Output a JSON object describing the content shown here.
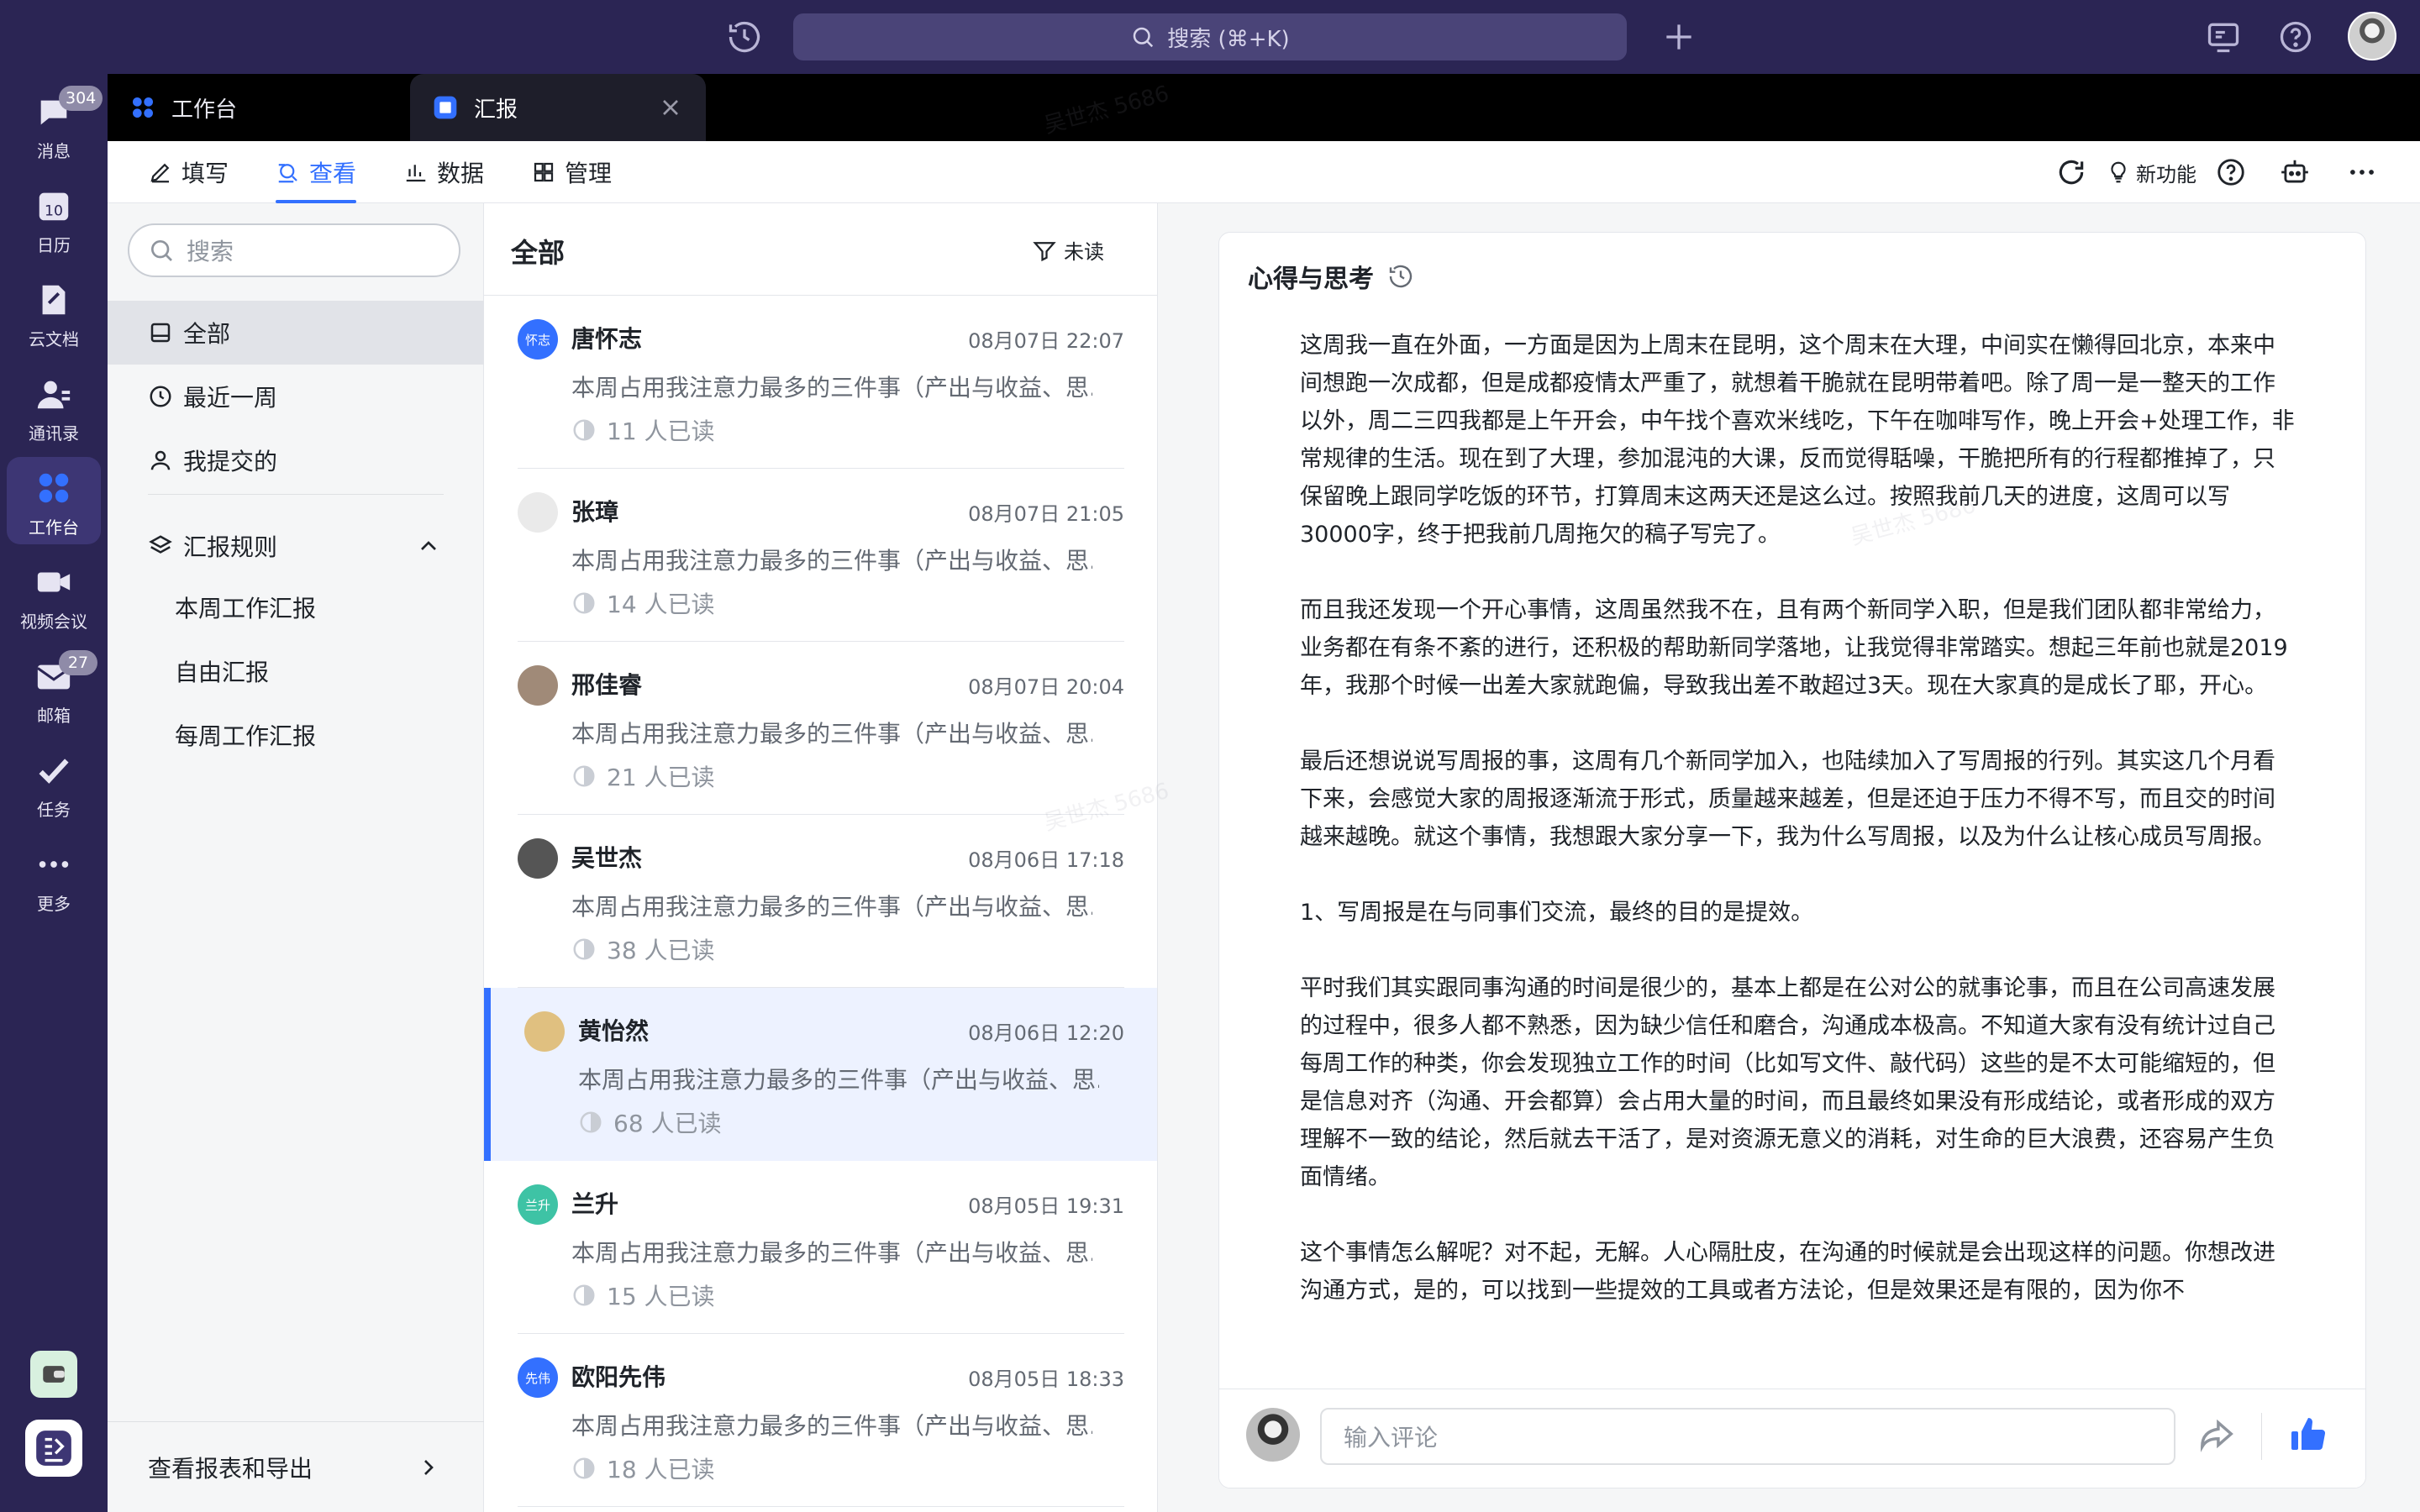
{
  "topbar": {
    "search_label": "搜索 (⌘+K)"
  },
  "rail": {
    "items": [
      {
        "label": "消息",
        "badge": "304"
      },
      {
        "label": "日历",
        "calendar_day": "10"
      },
      {
        "label": "云文档"
      },
      {
        "label": "通讯录"
      },
      {
        "label": "工作台"
      },
      {
        "label": "视频会议"
      },
      {
        "label": "邮箱",
        "badge": "27"
      },
      {
        "label": "任务"
      },
      {
        "label": "更多"
      }
    ]
  },
  "window_tabs": [
    {
      "label": "工作台"
    },
    {
      "label": "汇报"
    }
  ],
  "app_tabs": [
    {
      "label": "填写"
    },
    {
      "label": "查看"
    },
    {
      "label": "数据"
    },
    {
      "label": "管理"
    }
  ],
  "toolbar": {
    "new_feature_label": "新功能"
  },
  "sidebar": {
    "search_placeholder": "搜索",
    "items": [
      {
        "label": "全部"
      },
      {
        "label": "最近一周"
      },
      {
        "label": "我提交的"
      }
    ],
    "rules_label": "汇报规则",
    "rules": [
      {
        "label": "本周工作汇报"
      },
      {
        "label": "自由汇报"
      },
      {
        "label": "每周工作汇报"
      }
    ],
    "footer_label": "查看报表和导出"
  },
  "list": {
    "title": "全部",
    "filter_label": "未读",
    "reports": [
      {
        "name": "唐怀志",
        "avatar_text": "怀志",
        "avatar_color": "#3370ff",
        "time": "08月07日 22:07",
        "summary": "本周占用我注意力最多的三件事（产出与收益、思...",
        "read": "11 人已读"
      },
      {
        "name": "张璋",
        "avatar_text": "",
        "avatar_color": "#eaeaea",
        "time": "08月07日 21:05",
        "summary": "本周占用我注意力最多的三件事（产出与收益、思...",
        "read": "14 人已读"
      },
      {
        "name": "邢佳睿",
        "avatar_text": "",
        "avatar_color": "#a08a78",
        "time": "08月07日 20:04",
        "summary": "本周占用我注意力最多的三件事（产出与收益、思...",
        "read": "21 人已读"
      },
      {
        "name": "吴世杰",
        "avatar_text": "",
        "avatar_color": "#555555",
        "time": "08月06日 17:18",
        "summary": "本周占用我注意力最多的三件事（产出与收益、思...",
        "read": "38 人已读"
      },
      {
        "name": "黄怡然",
        "avatar_text": "",
        "avatar_color": "#e0c080",
        "time": "08月06日 12:20",
        "summary": "本周占用我注意力最多的三件事（产出与收益、思...",
        "read": "68 人已读"
      },
      {
        "name": "兰升",
        "avatar_text": "兰升",
        "avatar_color": "#3ec3a5",
        "time": "08月05日 19:31",
        "summary": "本周占用我注意力最多的三件事（产出与收益、思...",
        "read": "15 人已读"
      },
      {
        "name": "欧阳先伟",
        "avatar_text": "先伟",
        "avatar_color": "#3370ff",
        "time": "08月05日 18:33",
        "summary": "本周占用我注意力最多的三件事（产出与收益、思...",
        "read": "18 人已读"
      }
    ]
  },
  "detail": {
    "title": "心得与思考",
    "paragraphs": [
      "这周我一直在外面，一方面是因为上周末在昆明，这个周末在大理，中间实在懒得回北京，本来中间想跑一次成都，但是成都疫情太严重了，就想着干脆就在昆明带着吧。除了周一是一整天的工作以外，周二三四我都是上午开会，中午找个喜欢米线吃，下午在咖啡写作，晚上开会+处理工作，非常规律的生活。现在到了大理，参加混沌的大课，反而觉得聒噪，干脆把所有的行程都推掉了，只保留晚上跟同学吃饭的环节，打算周末这两天还是这么过。按照我前几天的进度，这周可以写30000字，终于把我前几周拖欠的稿子写完了。",
      "而且我还发现一个开心事情，这周虽然我不在，且有两个新同学入职，但是我们团队都非常给力，业务都在有条不紊的进行，还积极的帮助新同学落地，让我觉得非常踏实。想起三年前也就是2019年，我那个时候一出差大家就跑偏，导致我出差不敢超过3天。现在大家真的是成长了耶，开心。",
      "最后还想说说写周报的事，这周有几个新同学加入，也陆续加入了写周报的行列。其实这几个月看下来，会感觉大家的周报逐渐流于形式，质量越来越差，但是还迫于压力不得不写，而且交的时间越来越晚。就这个事情，我想跟大家分享一下，我为什么写周报，以及为什么让核心成员写周报。",
      "1、写周报是在与同事们交流，最终的目的是提效。",
      "平时我们其实跟同事沟通的时间是很少的，基本上都是在公对公的就事论事，而且在公司高速发展的过程中，很多人都不熟悉，因为缺少信任和磨合，沟通成本极高。不知道大家有没有统计过自己每周工作的种类，你会发现独立工作的时间（比如写文件、敲代码）这些的是不太可能缩短的，但是信息对齐（沟通、开会都算）会占用大量的时间，而且最终如果没有形成结论，或者形成的双方理解不一致的结论，然后就去干活了，是对资源无意义的消耗，对生命的巨大浪费，还容易产生负面情绪。",
      "这个事情怎么解呢？对不起，无解。人心隔肚皮，在沟通的时候就是会出现这样的问题。你想改进沟通方式，是的，可以找到一些提效的工具或者方法论，但是效果还是有限的，因为你不"
    ],
    "comment_placeholder": "输入评论"
  },
  "colors": {
    "accent": "#3370ff",
    "rail_bg": "#2b2554"
  }
}
